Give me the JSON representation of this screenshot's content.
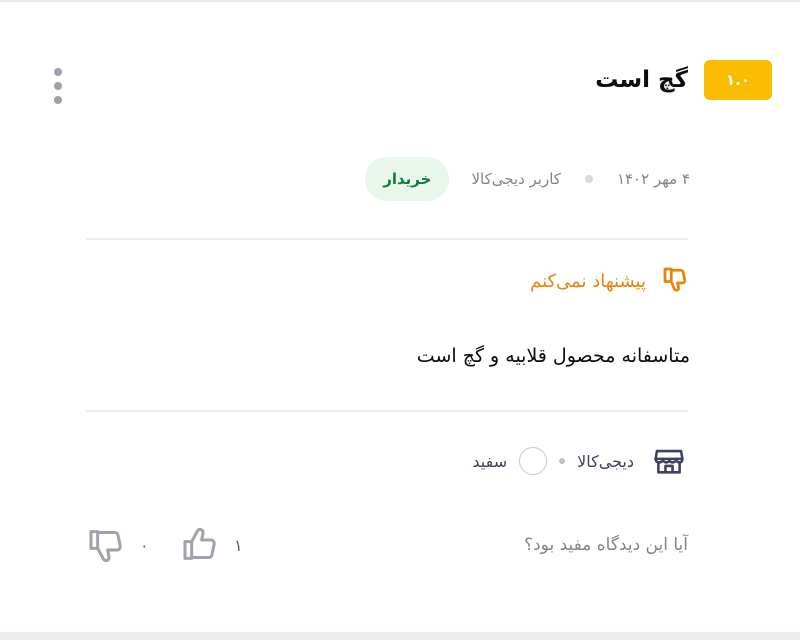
{
  "review": {
    "rating": "۱.۰",
    "title": "گچ است",
    "date": "۴ مهر ۱۴۰۲",
    "author": "کاربر دیجی‌کالا",
    "buyer_badge": "خریدار",
    "recommendation": "پیشنهاد نمی‌کنم",
    "body": "متاسفانه محصول قلابیه و گچ است"
  },
  "purchase": {
    "seller": "دیجی‌کالا",
    "color_name": "سفید",
    "color_hex": "#ffffff"
  },
  "feedback": {
    "question": "آیا این دیدگاه مفید بود؟",
    "likes": "۱",
    "dislikes": "۰"
  },
  "colors": {
    "rating_badge": "#f9bc00",
    "buyer_badge_bg": "#e8f6ec",
    "buyer_badge_text": "#0d7e3c",
    "not_recommend": "#e8840b"
  },
  "icons": {
    "more": "more-vertical-icon",
    "recommend": "thumb-down-icon",
    "seller": "store-icon",
    "like": "thumb-up-icon",
    "dislike": "thumb-down-icon"
  }
}
